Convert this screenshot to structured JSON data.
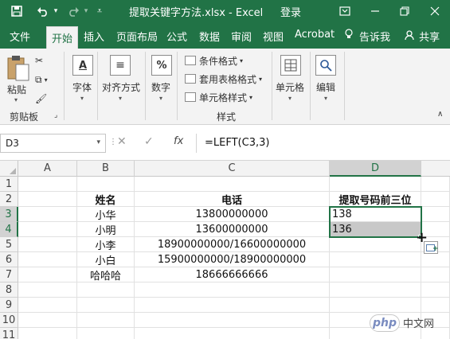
{
  "titlebar": {
    "title": "提取关键字方法.xlsx  -  Excel",
    "login": "登录",
    "save_icon": "save-icon",
    "undo_icon": "undo-icon",
    "redo_icon": "redo-icon"
  },
  "tabs": [
    {
      "label": "文件"
    },
    {
      "label": "开始",
      "active": true
    },
    {
      "label": "插入"
    },
    {
      "label": "页面布局"
    },
    {
      "label": "公式"
    },
    {
      "label": "数据"
    },
    {
      "label": "审阅"
    },
    {
      "label": "视图"
    },
    {
      "label": "Acrobat"
    },
    {
      "label": "告诉我"
    }
  ],
  "share_label": "共享",
  "ribbon": {
    "paste": "粘贴",
    "clipboard_group": "剪贴板",
    "font": "字体",
    "alignment": "对齐方式",
    "number": "数字",
    "conditional_format": "条件格式",
    "table_format": "套用表格格式",
    "cell_style": "单元格样式",
    "styles_group": "样式",
    "cells": "单元格",
    "edit": "编辑"
  },
  "formula_bar": {
    "name_box": "D3",
    "fx": "fx",
    "formula": "=LEFT(C3,3)"
  },
  "columns": [
    "A",
    "B",
    "C",
    "D"
  ],
  "rows": [
    "1",
    "2",
    "3",
    "4",
    "5",
    "6",
    "7",
    "8",
    "9",
    "10",
    "11"
  ],
  "cells": {
    "B2": "姓名",
    "C2": "电话",
    "D2": "提取号码前三位",
    "B3": "小华",
    "C3": "13800000000",
    "D3": "138",
    "B4": "小明",
    "C4": "13600000000",
    "D4": "136",
    "B5": "小李",
    "C5": "18900000000/16600000000",
    "B6": "小白",
    "C6": "15900000000/18900000000",
    "B7": "哈哈哈",
    "C7": "18666666666"
  },
  "selected_column": "D",
  "selected_rows": [
    "3",
    "4"
  ],
  "watermark": {
    "logo": "php",
    "text": "中文网"
  },
  "colors": {
    "excel_green": "#217346",
    "selection_fill": "#c8c8c8"
  }
}
